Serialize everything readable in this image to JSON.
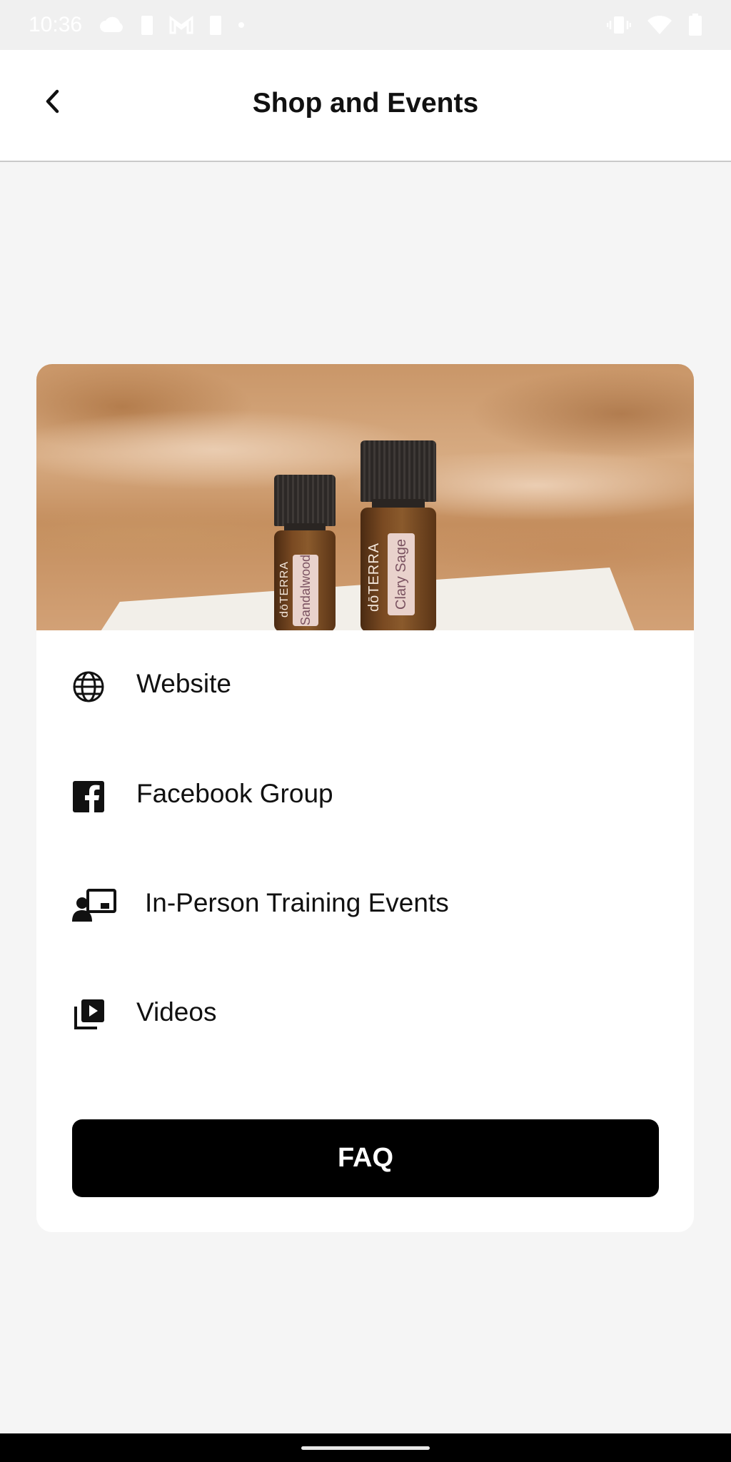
{
  "status_bar": {
    "time": "10:36",
    "left_icons": [
      "cloud-icon",
      "sim-alert-icon",
      "gmail-icon",
      "battery-saver-icon",
      "dot-icon"
    ],
    "right_icons": [
      "vibrate-icon",
      "wifi-icon",
      "battery-icon"
    ]
  },
  "header": {
    "title": "Shop and Events",
    "back_icon": "chevron-left-icon"
  },
  "hero": {
    "bottle_small": {
      "label": "Sandalwood",
      "brand": "dōTERRA"
    },
    "bottle_large": {
      "label": "Clary Sage",
      "brand": "dōTERRA"
    }
  },
  "menu": {
    "items": [
      {
        "label": "Website",
        "icon": "globe-icon"
      },
      {
        "label": "Facebook Group",
        "icon": "facebook-icon"
      },
      {
        "label": "In-Person Training Events",
        "icon": "presentation-icon"
      },
      {
        "label": "Videos",
        "icon": "video-library-icon"
      }
    ]
  },
  "faq": {
    "label": "FAQ"
  },
  "colors": {
    "background": "#f5f5f5",
    "card": "#ffffff",
    "button": "#000000",
    "button_text": "#ffffff"
  }
}
